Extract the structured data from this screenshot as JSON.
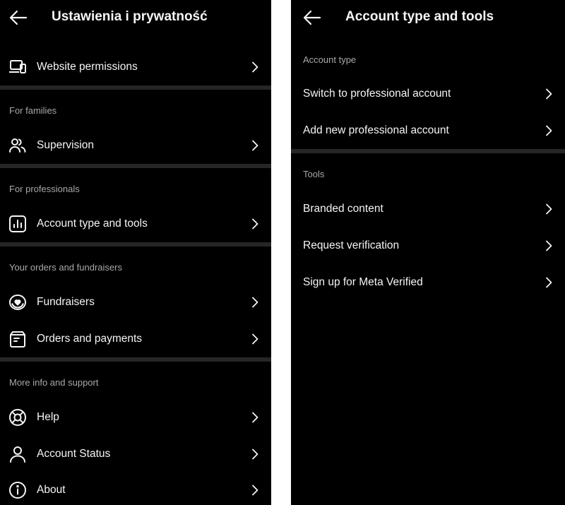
{
  "left_screen": {
    "title": "Ustawienia i prywatność",
    "website_permissions": "Website permissions",
    "families_label": "For families",
    "supervision": "Supervision",
    "professionals_label": "For professionals",
    "account_type_tools": "Account type and tools",
    "orders_label": "Your orders and fundraisers",
    "fundraisers": "Fundraisers",
    "orders_payments": "Orders and payments",
    "more_info_label": "More info and support",
    "help": "Help",
    "account_status": "Account Status",
    "about": "About"
  },
  "right_screen": {
    "title": "Account type and tools",
    "account_type_label": "Account type",
    "switch_professional": "Switch to professional account",
    "add_professional": "Add new professional account",
    "tools_label": "Tools",
    "branded_content": "Branded content",
    "request_verification": "Request verification",
    "meta_verified": "Sign up for Meta Verified"
  },
  "icons": {
    "back": "arrow-left-icon",
    "website_permissions": "devices-icon",
    "supervision": "people-icon",
    "account_type_tools": "bar-chart-icon",
    "fundraisers": "heart-coin-icon",
    "orders_payments": "receipt-box-icon",
    "help": "lifebuoy-icon",
    "account_status": "person-icon",
    "about": "info-icon",
    "row_arrow": "chevron-right-icon"
  },
  "colors": {
    "background": "#000000",
    "text": "#f5f5f5",
    "secondary_text": "#a8a8a8",
    "divider": "#262626",
    "gutter": "#ffffff"
  }
}
